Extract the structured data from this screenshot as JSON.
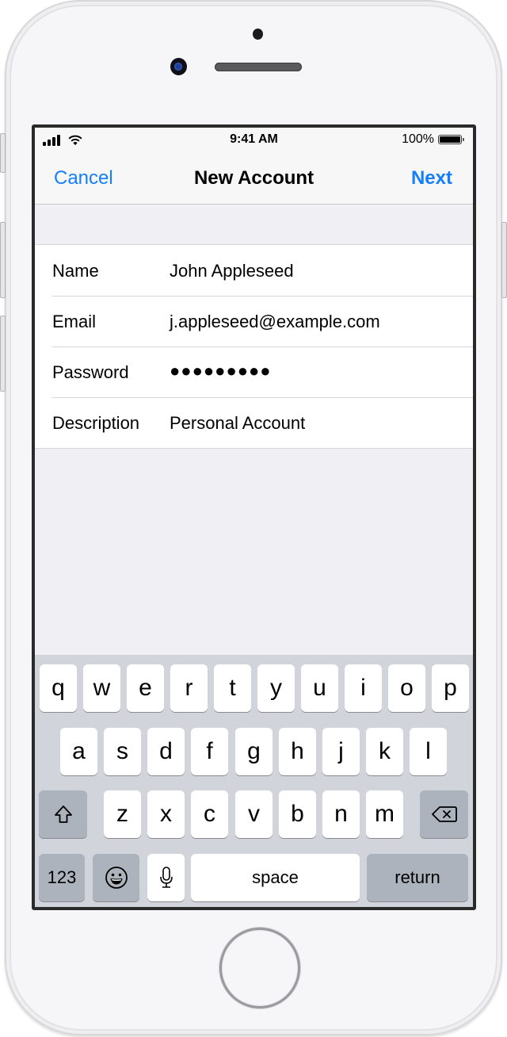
{
  "status_bar": {
    "time": "9:41 AM",
    "battery_percent": "100%",
    "signal_bars": 4,
    "battery_level": 1.0
  },
  "nav": {
    "cancel_label": "Cancel",
    "title": "New Account",
    "next_label": "Next"
  },
  "form": {
    "rows": [
      {
        "label": "Name",
        "value": "John Appleseed"
      },
      {
        "label": "Email",
        "value": "j.appleseed@example.com"
      },
      {
        "label": "Password",
        "value": "●●●●●●●●●"
      },
      {
        "label": "Description",
        "value": "Personal Account"
      }
    ]
  },
  "keyboard": {
    "row1": [
      "q",
      "w",
      "e",
      "r",
      "t",
      "y",
      "u",
      "i",
      "o",
      "p"
    ],
    "row2": [
      "a",
      "s",
      "d",
      "f",
      "g",
      "h",
      "j",
      "k",
      "l"
    ],
    "row3": [
      "z",
      "x",
      "c",
      "v",
      "b",
      "n",
      "m"
    ],
    "numbers_label": "123",
    "space_label": "space",
    "return_label": "return"
  },
  "colors": {
    "accent": "#147efb",
    "keyboard_bg": "#d1d5db",
    "function_key": "#acb3bd",
    "grouped_bg": "#efeff4"
  }
}
